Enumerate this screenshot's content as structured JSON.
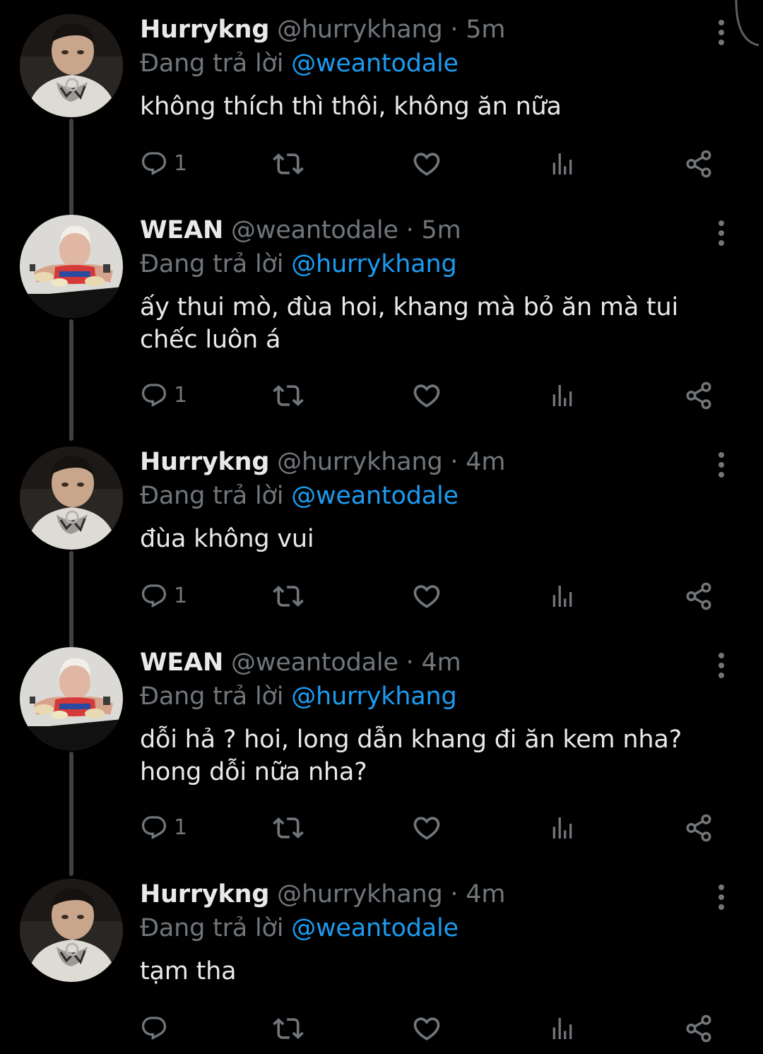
{
  "colors": {
    "background": "#000000",
    "text_primary": "#e7e9ea",
    "text_secondary": "#71767b",
    "mention": "#1d9bf0",
    "thread_line": "#3e4144"
  },
  "tweets": [
    {
      "name": "Hurrykng",
      "handle": "@hurrykhang",
      "separator": "·",
      "time": "5m",
      "replying_label": "Đang trả lời",
      "replying_to": "@weantodale",
      "text": "không thích thì thôi, không ăn nữa",
      "reply_count": "1",
      "avatar": "hurrykng-avatar"
    },
    {
      "name": "WEAN",
      "handle": "@weantodale",
      "separator": "·",
      "time": "5m",
      "replying_label": "Đang trả lời",
      "replying_to": "@hurrykhang",
      "text": "ấy thui mò, đùa hoi, khang mà bỏ ăn mà tui chếc luôn á",
      "reply_count": "1",
      "avatar": "wean-avatar"
    },
    {
      "name": "Hurrykng",
      "handle": "@hurrykhang",
      "separator": "·",
      "time": "4m",
      "replying_label": "Đang trả lời",
      "replying_to": "@weantodale",
      "text": "đùa không vui",
      "reply_count": "1",
      "avatar": "hurrykng-avatar"
    },
    {
      "name": "WEAN",
      "handle": "@weantodale",
      "separator": "·",
      "time": "4m",
      "replying_label": "Đang trả lời",
      "replying_to": "@hurrykhang",
      "text": "dỗi hả ? hoi, long dẫn khang đi ăn kem nha? hong dỗi nữa nha?",
      "reply_count": "1",
      "avatar": "wean-avatar"
    },
    {
      "name": "Hurrykng",
      "handle": "@hurrykhang",
      "separator": "·",
      "time": "4m",
      "replying_label": "Đang trả lời",
      "replying_to": "@weantodale",
      "text": "tạm tha",
      "reply_count": "",
      "avatar": "hurrykng-avatar"
    }
  ]
}
